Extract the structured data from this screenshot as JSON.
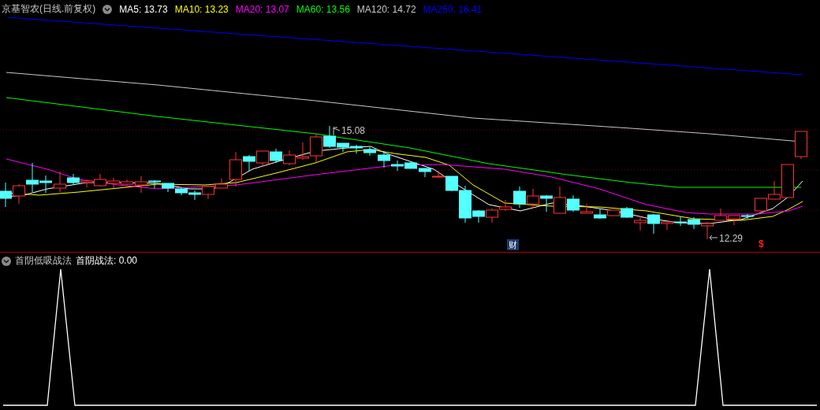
{
  "stock": {
    "title": "京基智农(日线.前复权)"
  },
  "legend": [
    {
      "label": "MA5: 13.73",
      "color": "#ffffff"
    },
    {
      "label": "MA10: 13.23",
      "color": "#ffff00"
    },
    {
      "label": "MA20: 13.07",
      "color": "#ff00ff"
    },
    {
      "label": "MA60: 13.56",
      "color": "#00ff00"
    },
    {
      "label": "MA120: 14.72",
      "color": "#c8c8c8"
    },
    {
      "label": "MA250: 16.41",
      "color": "#0000ff"
    }
  ],
  "price_marks": {
    "high": "15.08",
    "low": "12.29"
  },
  "event_marks": {
    "finance": "财",
    "dollar": "$"
  },
  "indicator": {
    "name": "首阴低吸战法",
    "reading": "首阴战法: 0.00"
  }
}
